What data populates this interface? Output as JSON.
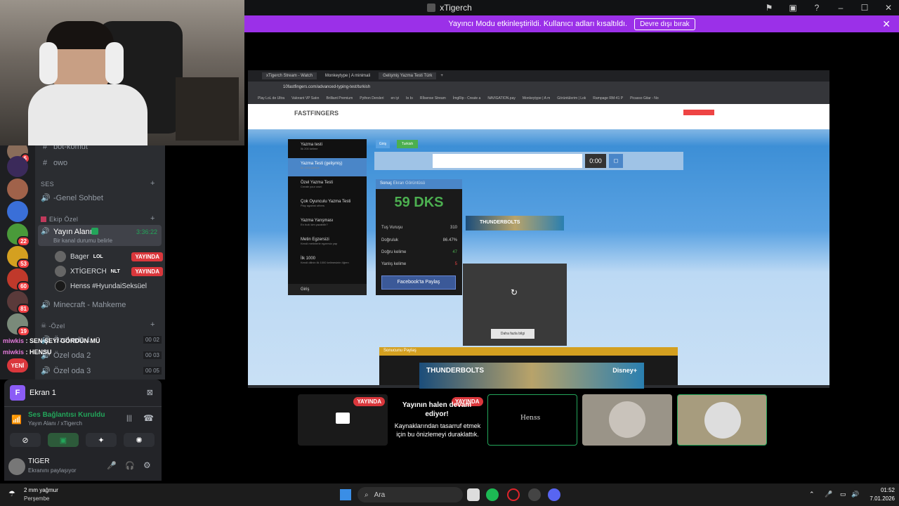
{
  "window": {
    "title": "xTigerch"
  },
  "banner": {
    "text": "Yayıncı Modu etkinleştirildi. Kullanıcı adları kısaltıldı.",
    "button": "Devre dışı bırak"
  },
  "servers": [
    {
      "badge": "6"
    },
    {
      "badge": ""
    },
    {
      "badge": ""
    },
    {
      "badge": "22"
    },
    {
      "badge": "53"
    },
    {
      "badge": "60"
    },
    {
      "badge": "81"
    },
    {
      "badge": "19"
    }
  ],
  "channels": {
    "bot_komut": "bot-komut",
    "owo": "owo",
    "voice_category": "SES",
    "genel_sohbet": "-Genel Sohbet",
    "ekip_category": "Ekip Özel",
    "yayin_alani": "Yayın Alanı",
    "yayin_timer": "3:36:22",
    "status_prompt": "Bir kanal durumu belirle",
    "members": [
      {
        "name": "Bager",
        "tag": "LOL",
        "live": "YAYINDA"
      },
      {
        "name": "XTİGERCH",
        "tag": "NLT",
        "live": "YAYINDA"
      },
      {
        "name": "Henss #HyundaiSeksüel",
        "tag": "",
        "live": ""
      }
    ],
    "minecraft": "Minecraft - Mahkeme",
    "ozel_category": "-Özel",
    "ozel_oda_1": {
      "name": "Özel oda 1",
      "a": "00",
      "b": "02"
    },
    "ozel_oda_2": {
      "name": "Özel oda 2",
      "a": "00",
      "b": "03"
    },
    "ozel_oda_3": {
      "name": "Özel oda 3",
      "a": "00",
      "b": "05"
    }
  },
  "chat_overlay": [
    {
      "user": "miwkis",
      "msg": "SEN ŞEYİ GÖRDÜN MÜ"
    },
    {
      "user": "miwkis",
      "msg": "HENSU"
    }
  ],
  "new_badge": "YENİ",
  "voice_panel": {
    "screen_title": "Ekran 1",
    "connection": "Ses Bağlantısı Kuruldu",
    "channel": "Yayın Alanı / xTigerch"
  },
  "user": {
    "name": "TIGER",
    "status": "Ekranını paylaşıyor"
  },
  "stream": {
    "tabs": [
      "xTigerch Stream - Watch",
      "Monkeytype | A minimali",
      "Gelişmiş Yazma Testi Türk"
    ],
    "url": "10fastfingers.com/advanced-typing-test/turkish",
    "bookmarks": [
      "Play LoL de Ultra",
      "Valorant VP Satın",
      "Brilliant Premium",
      "Python Dersleri",
      "en iyi",
      "bı bı",
      "Rİlsense Stream",
      "İmgRip - Create a",
      "NAVIGATION.pay",
      "Monkeytype | A m",
      "Görüntülerim | Lok",
      "Rampage RM-41 P",
      "Picasso Gitar - No"
    ],
    "logo": "FASTFINGERS",
    "login_btn": "Giriş",
    "lang_btn": "Turkish",
    "menu": [
      {
        "t": "Yazma testi",
        "s": "İlk 200 kelime"
      },
      {
        "t": "Yazma Testi (gelişmiş)",
        "s": "İlk 1000 kelime"
      },
      {
        "t": "Özel Yazma Testi",
        "s": "Create your own!"
      },
      {
        "t": "Çok Oyunculu Yazma Testi",
        "s": "Play against others"
      },
      {
        "t": "Yazma Yarışması",
        "s": "En hızlı kim yazabilir?"
      },
      {
        "t": "Metin Egzersizi",
        "s": "Kendi metinlerle egzersiz yap"
      },
      {
        "t": "İlk 1000",
        "s": "Kendi dilinin ilk 1000 kelimesinin öğren"
      },
      {
        "t": "Giriş",
        "s": ""
      }
    ],
    "timer": "0:00",
    "result_header": "Sonuç",
    "result_sub": "Ekran Görüntüsü",
    "wpm": "59 DKS",
    "rows": [
      {
        "k": "Tuş Vuruşu",
        "v": "310"
      },
      {
        "k": "Doğruluk",
        "v": "86.47%"
      },
      {
        "k": "Doğru kelime",
        "v": "47"
      },
      {
        "k": "Yanlış kelime",
        "v": "5"
      }
    ],
    "share_fb": "Facebook'ta Paylaş",
    "share_title": "Sonucunu Paylaş",
    "video_btn": "Daha fazla bilgi",
    "ad_text": "THUNDERBOLTS",
    "ad_sub": "Disney+"
  },
  "tiles": {
    "live": "YAYINDA",
    "paused_title": "Yayının halen devam ediyor!",
    "paused_text": "Kaynaklarından tasarruf etmek için bu önizlemeyi duraklattık.",
    "henss": "Henss"
  },
  "taskbar": {
    "weather": "2 mm yağmur",
    "day": "Perşembe",
    "search": "Ara",
    "time": "01:52",
    "date": "7.01.2026"
  }
}
